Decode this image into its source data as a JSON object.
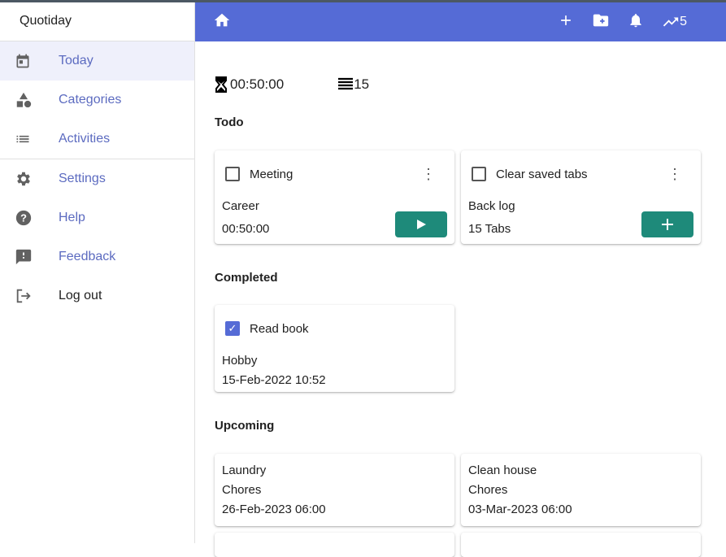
{
  "app": {
    "title": "Quotiday"
  },
  "sidebar": {
    "items": [
      {
        "label": "Today",
        "icon": "calendar-icon"
      },
      {
        "label": "Categories",
        "icon": "shapes-icon"
      },
      {
        "label": "Activities",
        "icon": "list-icon"
      },
      {
        "label": "Settings",
        "icon": "gear-icon"
      },
      {
        "label": "Help",
        "icon": "help-icon"
      },
      {
        "label": "Feedback",
        "icon": "feedback-icon"
      },
      {
        "label": "Log out",
        "icon": "logout-icon"
      }
    ]
  },
  "topbar": {
    "trend_count": "5"
  },
  "stats": {
    "time": "00:50:00",
    "count": "15"
  },
  "sections": {
    "todo": "Todo",
    "completed": "Completed",
    "upcoming": "Upcoming"
  },
  "todo": [
    {
      "title": "Meeting",
      "category": "Career",
      "detail": "00:50:00",
      "action": "play"
    },
    {
      "title": "Clear saved tabs",
      "category": "Back log",
      "detail": "15 Tabs",
      "action": "add"
    }
  ],
  "completed": [
    {
      "title": "Read book",
      "category": "Hobby",
      "detail": "15-Feb-2022 10:52",
      "checked": true
    }
  ],
  "upcoming": [
    {
      "title": "Laundry",
      "category": "Chores",
      "detail": "26-Feb-2023 06:00"
    },
    {
      "title": "Clean house",
      "category": "Chores",
      "detail": "03-Mar-2023 06:00"
    }
  ],
  "colors": {
    "primary": "#556bd6",
    "action": "#1e8a7a"
  }
}
